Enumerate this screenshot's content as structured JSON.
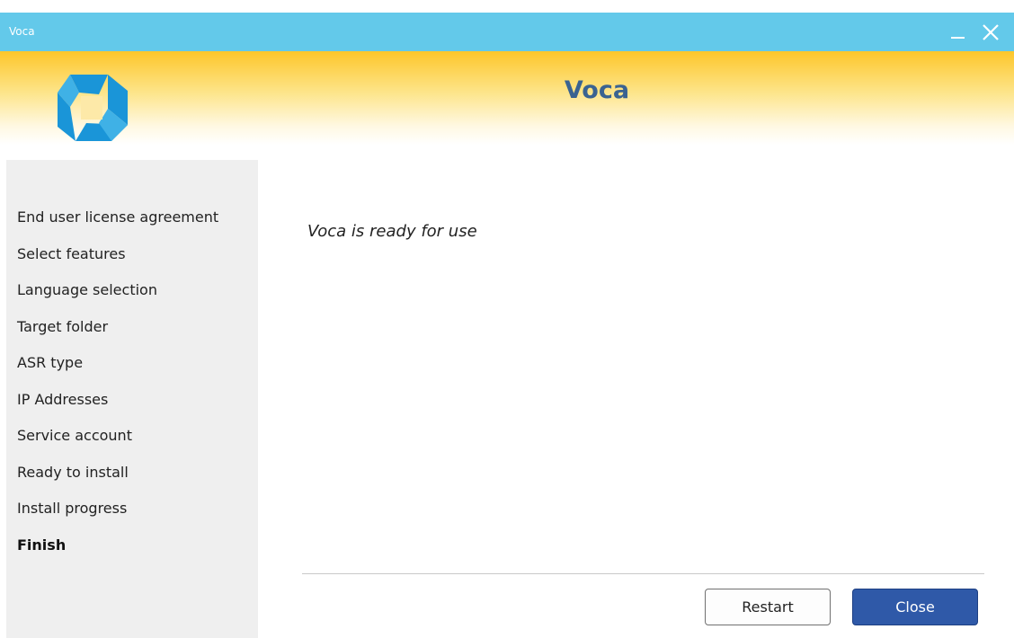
{
  "window": {
    "title": "Voca"
  },
  "titlebar_controls": {
    "minimize_icon": "minimize-icon",
    "close_icon": "close-icon"
  },
  "header": {
    "title": "Voca",
    "logo_icon": "voca-logo-icon"
  },
  "sidebar": {
    "items": [
      {
        "label": "End user license agreement"
      },
      {
        "label": "Select features"
      },
      {
        "label": "Language selection"
      },
      {
        "label": "Target folder"
      },
      {
        "label": "ASR type"
      },
      {
        "label": "IP Addresses"
      },
      {
        "label": "Service account"
      },
      {
        "label": "Ready to install"
      },
      {
        "label": "Install progress"
      },
      {
        "label": "Finish",
        "active": true
      }
    ]
  },
  "main": {
    "message": "Voca is ready for use"
  },
  "buttons": {
    "restart_label": "Restart",
    "close_label": "Close"
  },
  "colors": {
    "titlebar": "#63c9ea",
    "header_gradient_top": "#fdc62a",
    "accent_button": "#2f59a8",
    "title_text": "#3a6391",
    "logo": "#1a95d8"
  }
}
